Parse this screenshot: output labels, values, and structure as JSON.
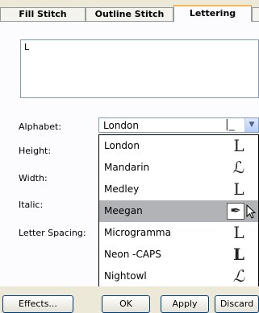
{
  "tabs": {
    "fill": "Fill Stitch",
    "outline": "Outline Stitch",
    "lettering": "Lettering"
  },
  "text_value": "L",
  "labels": {
    "alphabet": "Alphabet:",
    "height": "Height:",
    "width": "Width:",
    "italic": "Italic:",
    "letter_spacing": "Letter Spacing:"
  },
  "alphabet_combo": {
    "value": "London",
    "preview": "|_"
  },
  "dropdown": {
    "items": [
      {
        "label": "London",
        "glyph": "L"
      },
      {
        "label": "Mandarin",
        "glyph": "ℒ"
      },
      {
        "label": "Medley",
        "glyph": "L"
      },
      {
        "label": "Meegan",
        "glyph": "✒",
        "selected": true
      },
      {
        "label": "Microgramma",
        "glyph": "L"
      },
      {
        "label": "Neon -CAPS",
        "glyph": "L"
      },
      {
        "label": "Nightowl",
        "glyph": "ℒ"
      }
    ]
  },
  "buttons": {
    "effects": "Effects...",
    "ok": "OK",
    "apply": "Apply",
    "discard": "Discard"
  },
  "colors": {
    "active_tab_accent": "#f6b65a",
    "selected_row": "#b1b3b6",
    "border_blue": "#7f9db9"
  }
}
